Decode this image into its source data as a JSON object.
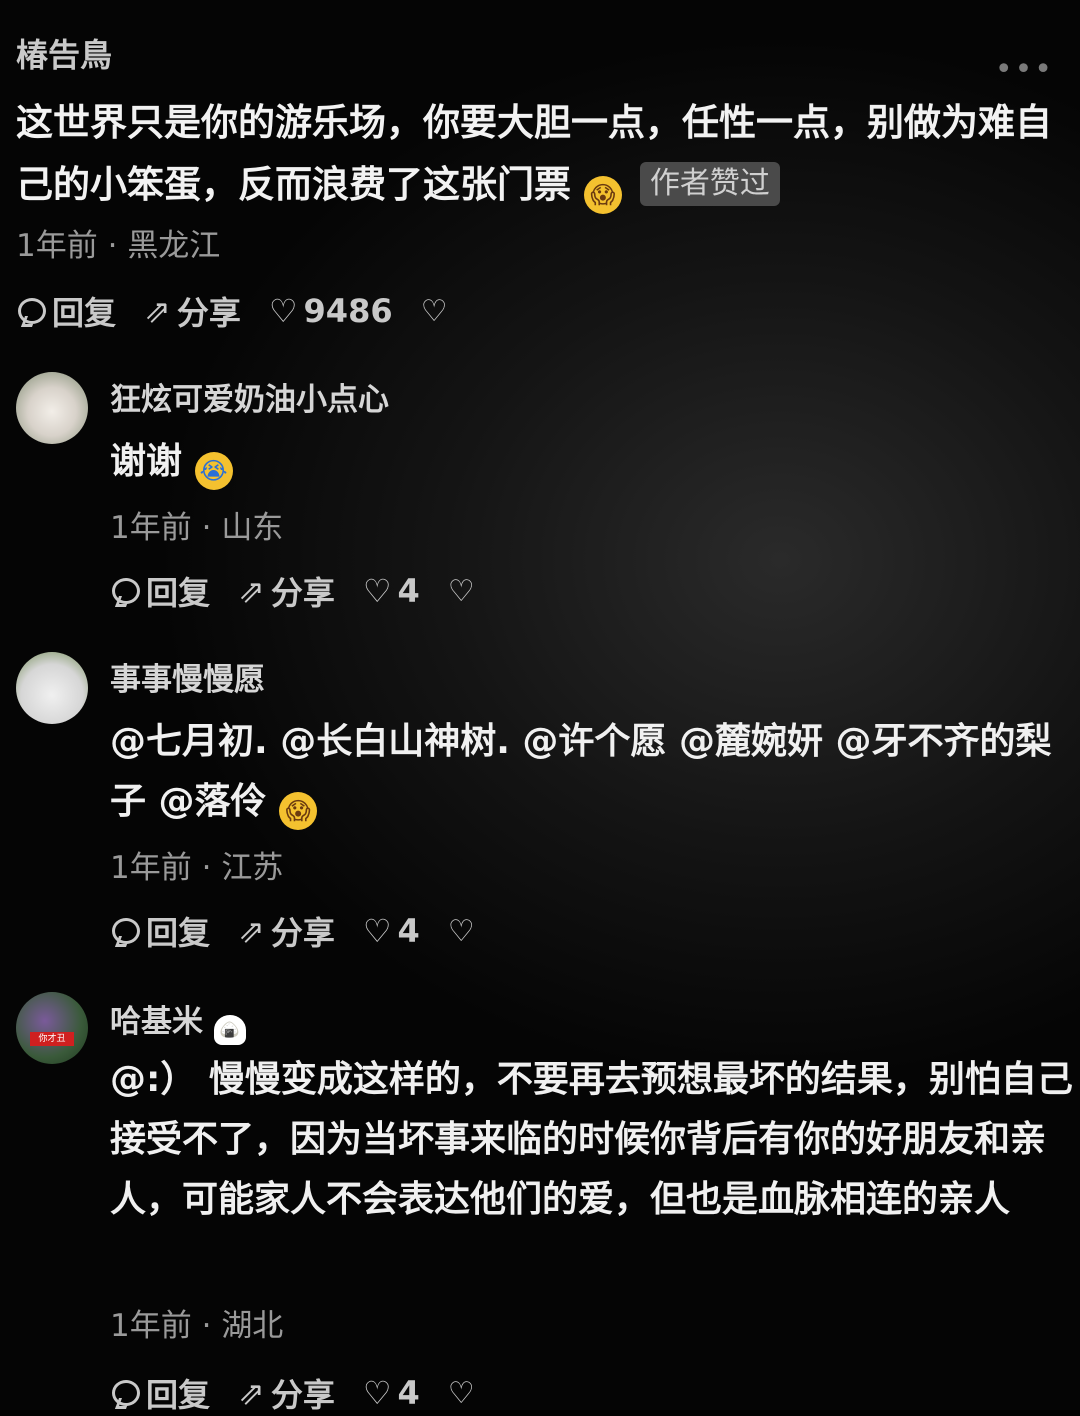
{
  "top_comment": {
    "author": "椿告鳥",
    "more_icon": "more-dots-icon",
    "text": "这世界只是你的游乐场，你要大胆一点，任性一点，别做为难自己的小笨蛋，反而浪费了这张门票",
    "author_liked_badge": "作者赞过",
    "time": "1年前",
    "location": "黑龙江",
    "reply_label": "回复",
    "share_label": "分享",
    "like_count": "9486"
  },
  "comments": [
    {
      "name": "狂炫可爱奶油小点心",
      "text": "谢谢",
      "time": "1年前",
      "location": "山东",
      "reply_label": "回复",
      "share_label": "分享",
      "like_count": "4"
    },
    {
      "name": "事事慢慢愿",
      "text": "@七月初. @长白山神树. @许个愿 @麓婉妍 @牙不齐的梨子 @落伶",
      "time": "1年前",
      "location": "江苏",
      "reply_label": "回复",
      "share_label": "分享",
      "like_count": "4"
    },
    {
      "name": "哈基米",
      "avatar_badge": "你才丑",
      "text": "@:） 慢慢变成这样的，不要再去预想最坏的结果，别怕自己接受不了，因为当坏事来临的时候你背后有你的好朋友和亲人，可能家人不会表达他们的爱，但也是血脉相连的亲人",
      "time": "1年前",
      "location": "湖北",
      "reply_label": "回复",
      "share_label": "分享",
      "like_count": "4"
    }
  ],
  "separator": "·",
  "colors": {
    "background": "#000000",
    "text": "#f0f0f0",
    "meta": "#9a9a9a",
    "badge_bg": "#4a4a4a"
  }
}
